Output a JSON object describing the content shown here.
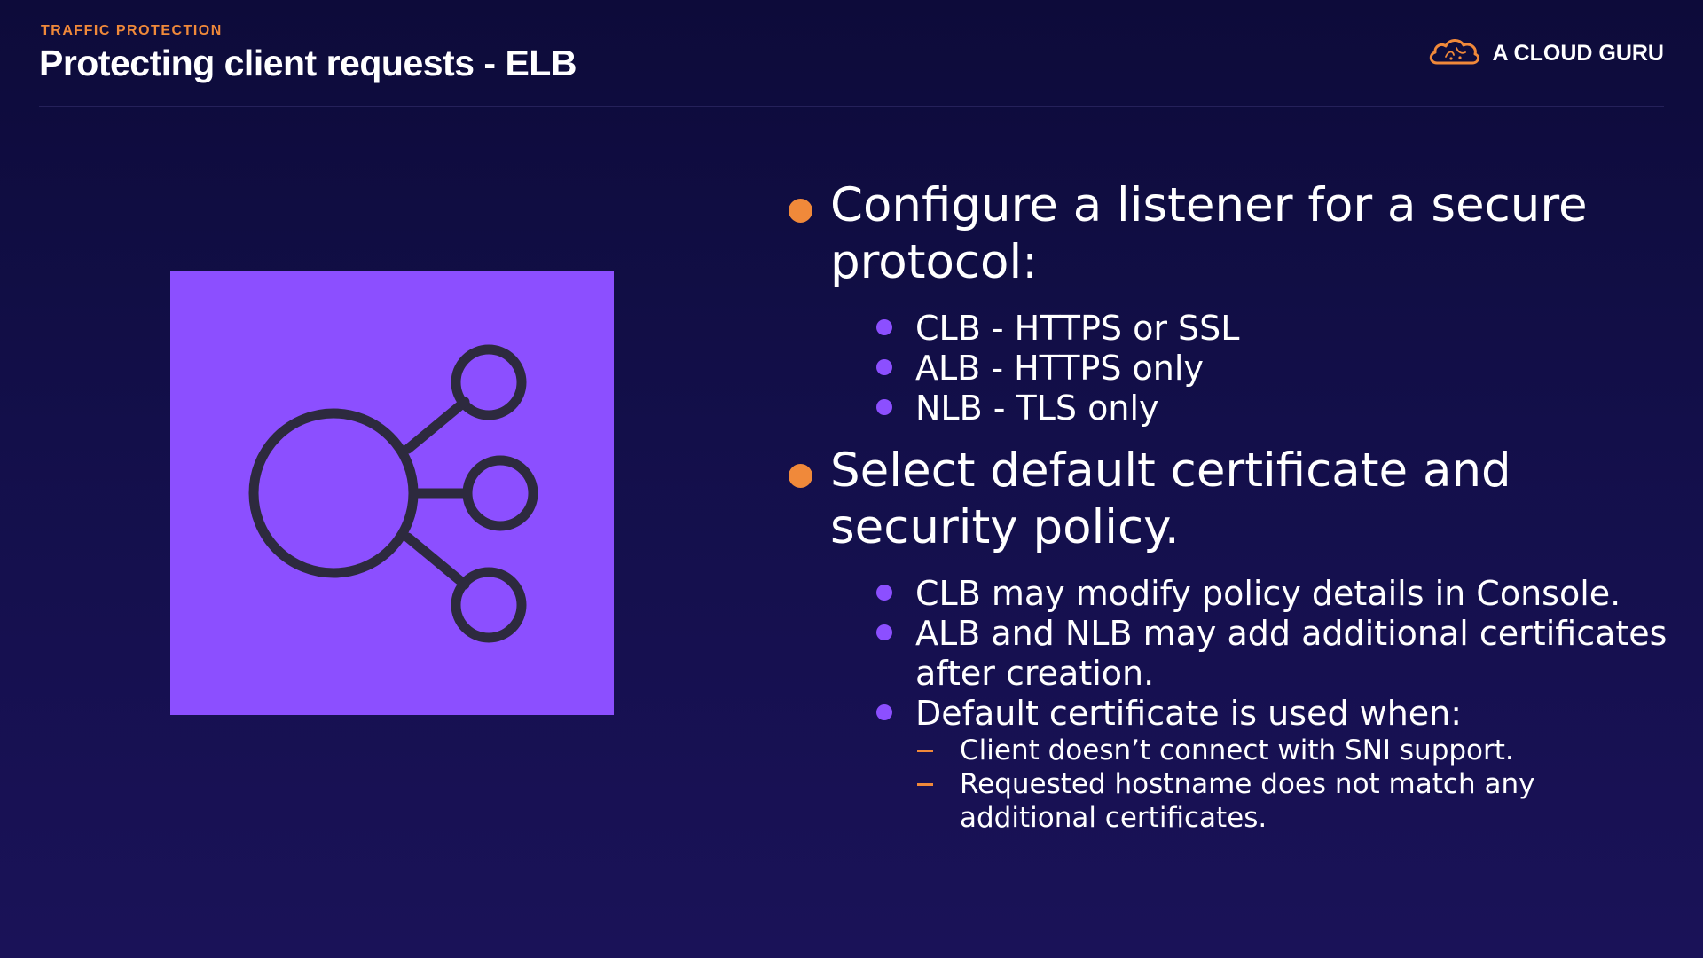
{
  "header": {
    "eyebrow": "TRAFFIC PROTECTION",
    "title": "Protecting client requests - ELB",
    "brand": "A CLOUD GURU"
  },
  "icon": {
    "name": "elastic-load-balancing-icon",
    "tile_color": "#8c4fff",
    "stroke_color": "#2d2a3e"
  },
  "colors": {
    "accent_orange": "#f0893a",
    "accent_purple": "#8c4fff",
    "background": "#130f4a"
  },
  "bullets": [
    {
      "text": "Configure a listener for a secure protocol:",
      "sub": [
        {
          "text": "CLB - HTTPS or SSL"
        },
        {
          "text": "ALB - HTTPS only"
        },
        {
          "text": "NLB - TLS only"
        }
      ]
    },
    {
      "text": "Select default certificate and security policy.",
      "sub": [
        {
          "text": "CLB may modify policy details in Console."
        },
        {
          "text": "ALB and NLB may add additional certificates after creation."
        },
        {
          "text": "Default certificate is used when:",
          "sub": [
            {
              "text": "Client doesn’t connect with SNI support."
            },
            {
              "text": "Requested hostname does not match any additional certificates."
            }
          ]
        }
      ]
    }
  ]
}
